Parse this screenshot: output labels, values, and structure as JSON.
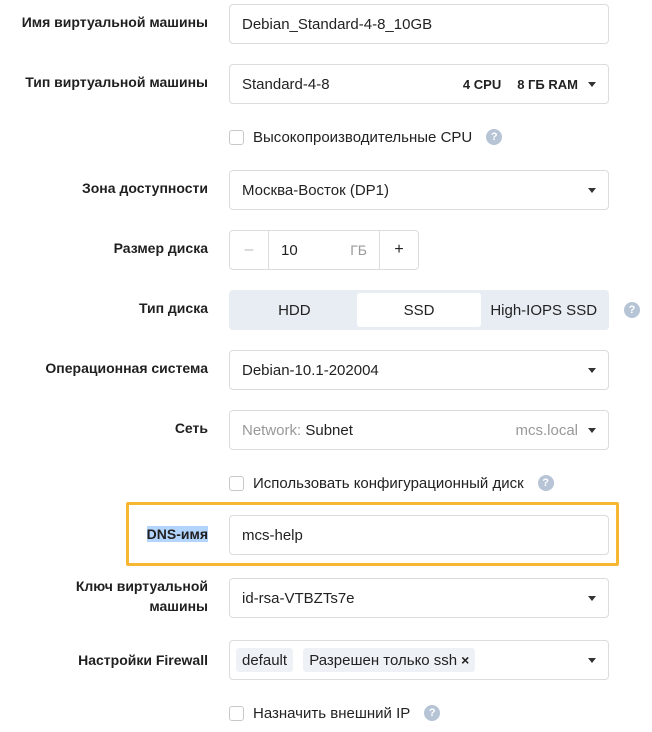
{
  "vm_name": {
    "label": "Имя виртуальной машины",
    "value": "Debian_Standard-4-8_10GB"
  },
  "vm_type": {
    "label": "Тип виртуальной машины",
    "value": "Standard-4-8",
    "cpu": "4 CPU",
    "ram": "8 ГБ RAM"
  },
  "high_perf_cpu": {
    "label": "Высокопроизводительные CPU",
    "help": "?"
  },
  "zone": {
    "label": "Зона доступности",
    "value": "Москва-Восток (DP1)"
  },
  "disk_size": {
    "label": "Размер диска",
    "minus": "–",
    "value": "10",
    "unit": "ГБ",
    "plus": "+"
  },
  "disk_type": {
    "label": "Тип диска",
    "options": [
      "HDD",
      "SSD",
      "High-IOPS SSD"
    ],
    "selected": "SSD",
    "help": "?"
  },
  "os": {
    "label": "Операционная система",
    "value": "Debian-10.1-202004"
  },
  "network": {
    "label": "Сеть",
    "prefix": "Network:",
    "value": "Subnet",
    "domain": "mcs.local"
  },
  "config_disk": {
    "label": "Использовать конфигурационный диск",
    "help": "?"
  },
  "dns": {
    "label": "DNS-имя",
    "value": "mcs-help"
  },
  "ssh_key": {
    "label_line1": "Ключ виртуальной",
    "label_line2": "машины",
    "value": "id-rsa-VTBZTs7e"
  },
  "firewall": {
    "label": "Настройки Firewall",
    "tags": [
      "default",
      "Разрешен только ssh"
    ],
    "remove": "×"
  },
  "external_ip": {
    "label": "Назначить внешний IP",
    "help": "?"
  },
  "colors": {
    "highlight": "#f7b733",
    "selection": "#b3d4fc",
    "help_icon": "#b6c4d6"
  }
}
